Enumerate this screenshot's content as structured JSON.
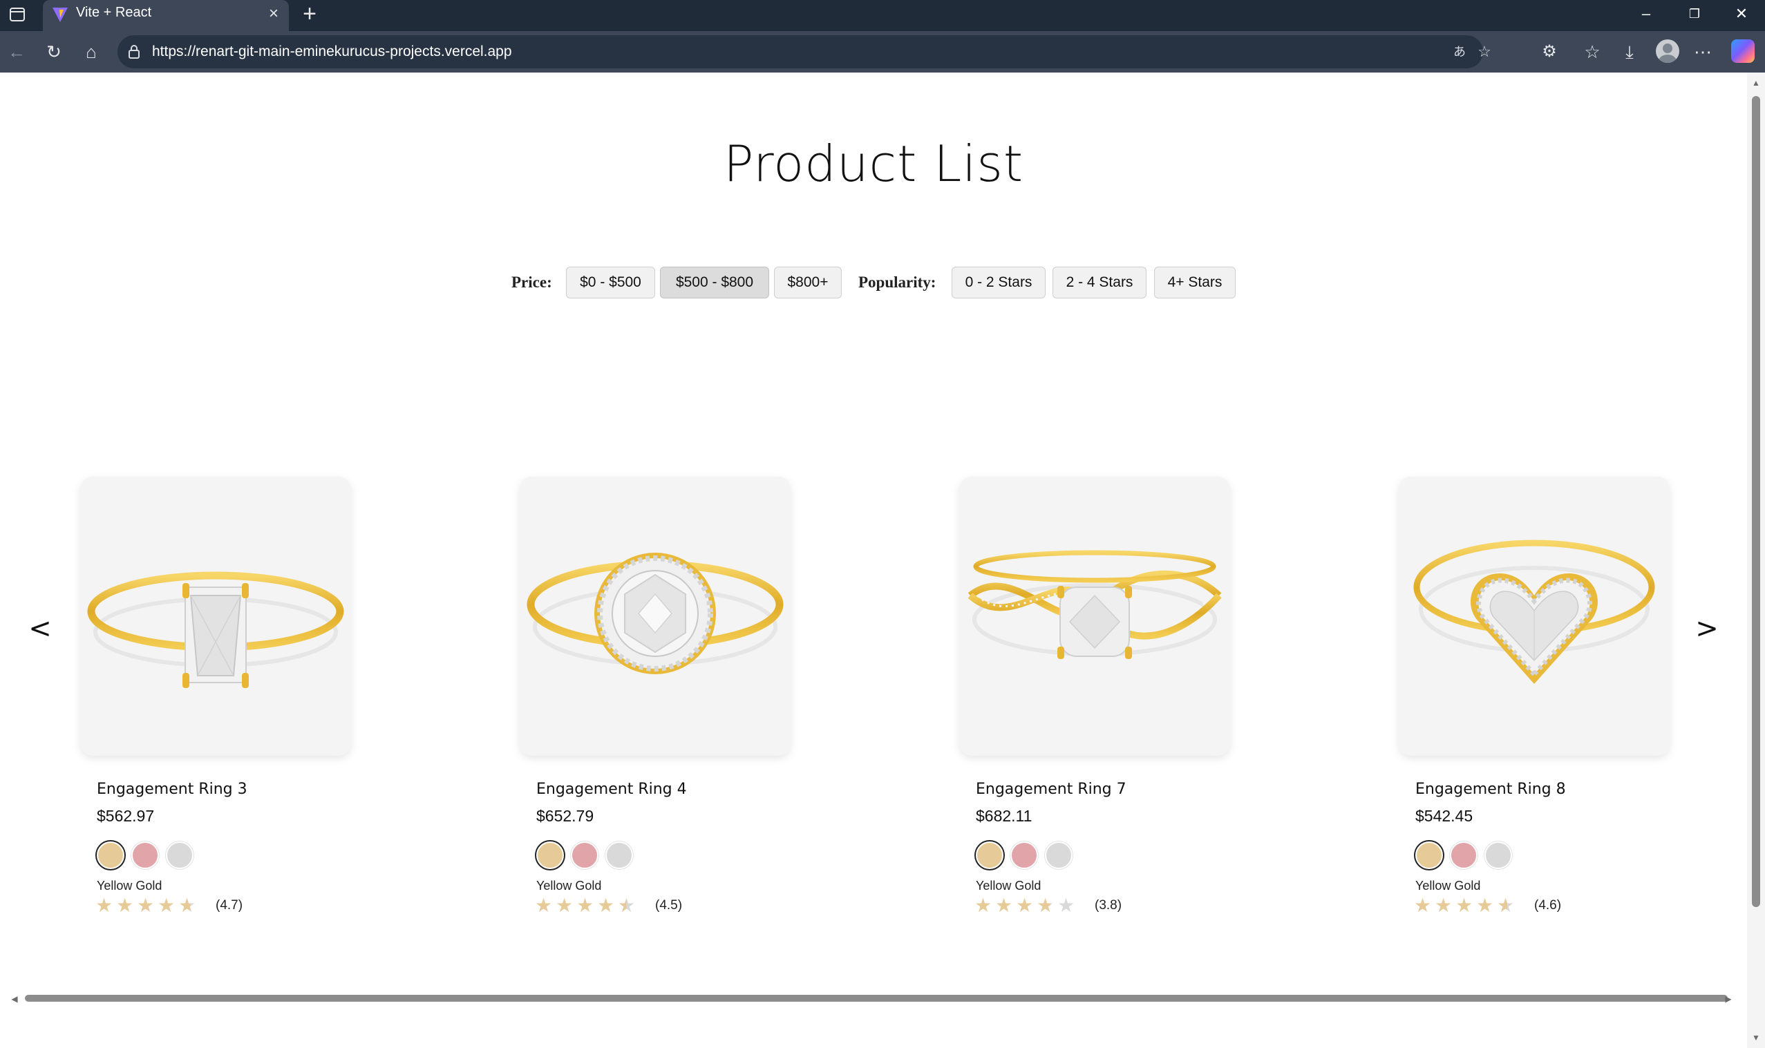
{
  "browser": {
    "tab_title": "Vite + React",
    "url": "https://renart-git-main-eminekurucus-projects.vercel.app",
    "new_tab_symbol": "+",
    "tab_close_symbol": "×",
    "window_controls": {
      "minimize": "–",
      "restore": "❐",
      "close": "✕"
    },
    "toolbar_icons": {
      "back": "←",
      "reload": "↻",
      "home": "⌂",
      "read_aloud": "あ",
      "favorite": "☆",
      "extensions": "⚙",
      "favorites": "☆",
      "downloads": "⤓",
      "more": "⋯"
    }
  },
  "page": {
    "title": "Product List",
    "filters": {
      "price_label": "Price:",
      "price_options": [
        "$0 - $500",
        "$500 - $800",
        "$800+"
      ],
      "price_active_index": 1,
      "popularity_label": "Popularity:",
      "popularity_options": [
        "0 - 2 Stars",
        "2 - 4 Stars",
        "4+ Stars"
      ]
    },
    "carousel": {
      "prev": "<",
      "next": ">"
    },
    "products": [
      {
        "name": "Engagement Ring 3",
        "price": "$562.97",
        "selected_metal": "Yellow Gold",
        "rating": 4.7,
        "rating_text": "(4.7)",
        "stone": "radiant"
      },
      {
        "name": "Engagement Ring 4",
        "price": "$652.79",
        "selected_metal": "Yellow Gold",
        "rating": 4.5,
        "rating_text": "(4.5)",
        "stone": "halo-round"
      },
      {
        "name": "Engagement Ring 7",
        "price": "$682.11",
        "selected_metal": "Yellow Gold",
        "rating": 3.8,
        "rating_text": "(3.8)",
        "stone": "twist-cushion"
      },
      {
        "name": "Engagement Ring 8",
        "price": "$542.45",
        "selected_metal": "Yellow Gold",
        "rating": 4.6,
        "rating_text": "(4.6)",
        "stone": "halo-heart"
      }
    ],
    "swatch_colors": [
      "#e6ca97",
      "#e1a4a9",
      "#d9d9d9"
    ],
    "star_color": "#e6ca97",
    "star_empty_color": "#d9d9d9"
  }
}
